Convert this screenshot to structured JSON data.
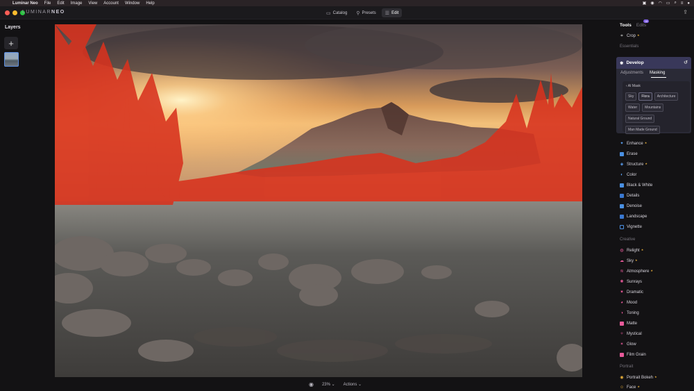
{
  "menubar": {
    "items": [
      "Luminar Neo",
      "File",
      "Edit",
      "Image",
      "View",
      "Account",
      "Window",
      "Help"
    ]
  },
  "app": {
    "logo_light": "LUMINAR",
    "logo_bold": "NEO",
    "modes": [
      {
        "label": "Catalog",
        "icon": "folder-icon"
      },
      {
        "label": "Presets",
        "icon": "presets-icon"
      },
      {
        "label": "Edit",
        "icon": "sliders-icon",
        "active": true
      }
    ]
  },
  "layers": {
    "title": "Layers",
    "add_label": "+"
  },
  "bottombar": {
    "zoom": "23%",
    "zoom_caret": "⌄",
    "actions": "Actions",
    "actions_caret": "⌄"
  },
  "tools": {
    "tab_tools": "Tools",
    "tab_edits": "Edits",
    "edits_badge": "18",
    "crop": "Crop",
    "essentials_title": "Essentials",
    "develop": {
      "title": "Develop",
      "tab_adjustments": "Adjustments",
      "tab_masking": "Masking",
      "ai_mask_label": "AI Mask",
      "chips": [
        "Sky",
        "Flora",
        "Architecture",
        "Water",
        "Mountains",
        "Natural Ground",
        "Man Made Ground"
      ]
    },
    "essentials": [
      "Enhance",
      "Erase",
      "Structure",
      "Color",
      "Black & White",
      "Details",
      "Denoise",
      "Landscape",
      "Vignette"
    ],
    "creative_title": "Creative",
    "creative": [
      "Relight",
      "Sky",
      "Atmosphere",
      "Sunrays",
      "Dramatic",
      "Mood",
      "Toning",
      "Matte",
      "Mystical",
      "Glow",
      "Film Grain"
    ],
    "portrait_title": "Portrait",
    "portrait": [
      "Portrait Bokeh",
      "Face"
    ]
  },
  "colors": {
    "accent": "#7a58e0",
    "develop_header": "#39385a",
    "mask_overlay": "#d8321e",
    "star": "#e0a93a"
  }
}
